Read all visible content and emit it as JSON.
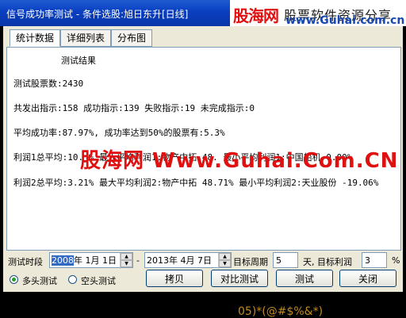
{
  "window": {
    "title": "信号成功率测试 - 条件选股:旭日东升[日线]"
  },
  "brand": {
    "name": "股海网",
    "tagline": "股票软件资源分享",
    "url": "www.Guhai.com.cn"
  },
  "tabs": [
    {
      "label": "统计数据",
      "active": true
    },
    {
      "label": "详细列表",
      "active": false
    },
    {
      "label": "分布图",
      "active": false
    }
  ],
  "results": {
    "heading": "测试结果",
    "total_stocks": "测试股票数:2430",
    "signals": "共发出指示:158 成功指示:139 失败指示:19 未完成指示:0",
    "success_rate": "平均成功率:87.97%, 成功率达到50%的股票有:5.3%",
    "profit1": "利润1总平均:10.   %  最大平均利润1:物产中拓  48.   最小平均利润1:中国船机  0.00%",
    "profit2": "利润2总平均:3.21% 最大平均利润2:物产中拓 48.71% 最小平均利润2:天业股份 -19.06%"
  },
  "watermark": "股海网 Www.Guhai.Com.CN",
  "controls": {
    "period_label": "测试时段",
    "start_year": "2008",
    "start_rest": "年  1月  1日",
    "dash": "-",
    "end_date": "2013年  4月  7日",
    "target_period_label": "目标周期",
    "target_period_value": "5",
    "day_profit_label": "天, 目标利润",
    "target_profit_value": "3",
    "percent": "%"
  },
  "radios": [
    {
      "label": "多头测试",
      "checked": true
    },
    {
      "label": "空头测试",
      "checked": false
    }
  ],
  "buttons": {
    "copy": "拷贝",
    "compare": "对比测试",
    "test": "测试",
    "close": "关闭"
  },
  "footer_fragment": "05)*(@#$%&*)"
}
